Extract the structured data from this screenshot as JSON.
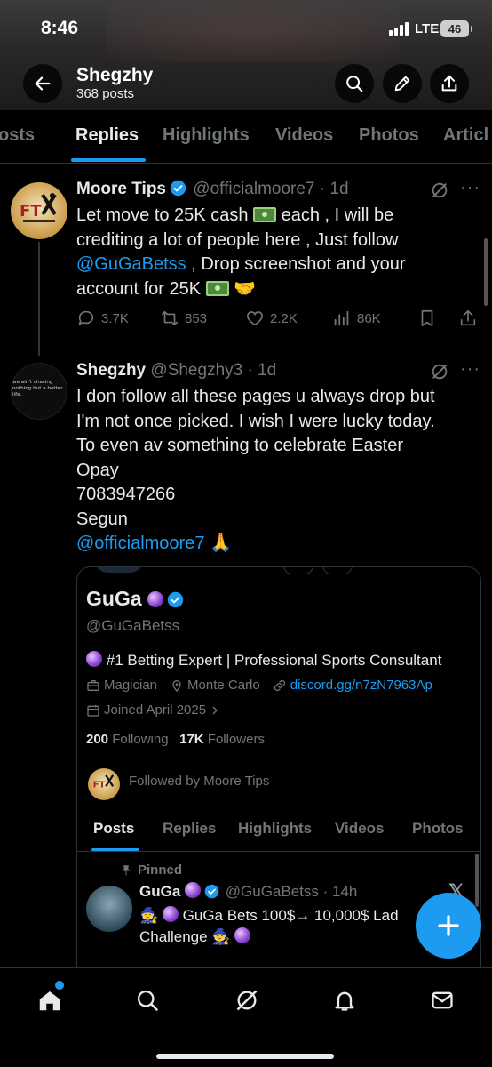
{
  "status_bar": {
    "time": "8:46",
    "network": "LTE",
    "battery": "46"
  },
  "header": {
    "name": "Shegzhy",
    "posts_count": "368 posts"
  },
  "tabs": [
    "Posts",
    "Replies",
    "Highlights",
    "Videos",
    "Photos",
    "Articles"
  ],
  "tabs_visible": [
    "osts",
    "Replies",
    "Highlights",
    "Videos",
    "Photos",
    "Articl"
  ],
  "tweet1": {
    "name": "Moore Tips",
    "handle": "@officialmoore7 · 1d",
    "body_line1": "Let move to 25K cash",
    "body_line1b": "each , I will be",
    "body_line2": "crediting a lot of people here , Just follow",
    "mention": "@GuGaBetss",
    "body_line3": ", Drop screenshot and your",
    "body_line4": "account for 25K",
    "replies": "3.7K",
    "reposts": "853",
    "likes": "2.2K",
    "views": "86K",
    "avatar_text": "FT"
  },
  "tweet2": {
    "name": "Shegzhy",
    "handle": "@Shegzhy3 · 1d",
    "lines": [
      "I don follow all these pages u always drop but",
      "I'm not once picked. I wish I were lucky today.",
      "To even av something to celebrate Easter",
      "Opay",
      "7083947266",
      "Segun"
    ],
    "mention": "@officialmoore7",
    "avatar_text": "we ain't chasing nothing but a better life."
  },
  "card": {
    "name": "GuGa",
    "handle": "@GuGaBetss",
    "bio": "#1 Betting Expert | Professional Sports Consultant",
    "job": "Magician",
    "location": "Monte Carlo",
    "link": "discord.gg/n7zN7963Ap",
    "joined": "Joined April 2025",
    "following_count": "200",
    "following_label": "Following",
    "followers_count": "17K",
    "followers_label": "Followers",
    "followed_by": "Followed by Moore Tips",
    "tabs": [
      "Posts",
      "Replies",
      "Highlights",
      "Videos",
      "Photos"
    ],
    "pinned_label": "Pinned",
    "pinned_post": {
      "name": "GuGa",
      "handle": "@GuGaBetss · 14h",
      "line1": "GuGa Bets 100$→ 10,000$ Lad",
      "line2": "Challenge"
    }
  },
  "colors": {
    "accent": "#1d9bf0",
    "muted": "#71767b",
    "text": "#e7e9ea",
    "background": "#000000"
  }
}
